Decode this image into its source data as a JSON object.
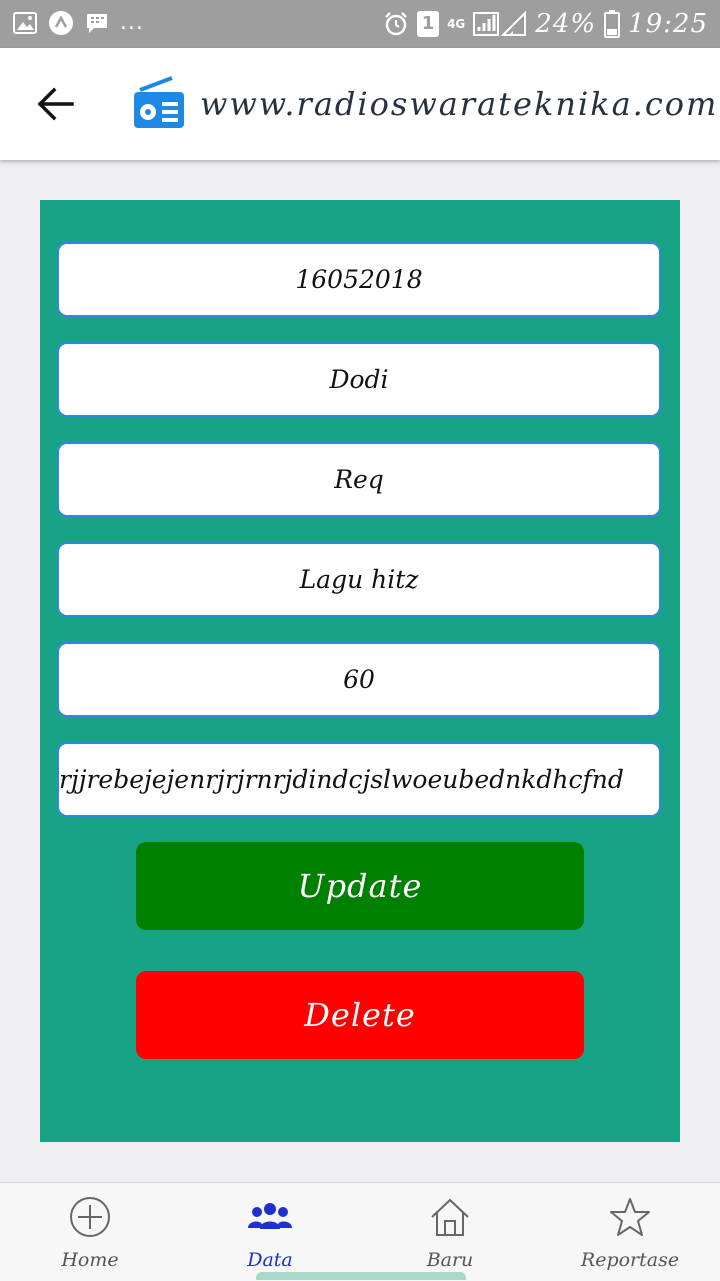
{
  "status_bar": {
    "dots": "...",
    "sim": "1",
    "network": "4G",
    "battery": "24%",
    "time": "19:25"
  },
  "app_bar": {
    "title": "www.radioswarateknika.com",
    "back_icon": "arrow-left-icon",
    "logo_icon": "radio-icon"
  },
  "form": {
    "fields": [
      {
        "value": "16052018"
      },
      {
        "value": "Dodi"
      },
      {
        "value": "Req"
      },
      {
        "value": "Lagu hitz"
      },
      {
        "value": "60"
      },
      {
        "value": "rjjrebejejenrjrjrnrjdindcjslwoeubednkdhcfnd"
      }
    ],
    "update_label": "Update",
    "delete_label": "Delete",
    "colors": {
      "panel": "#19a386",
      "update": "#008000",
      "delete": "#ff0000"
    }
  },
  "bottom_nav": {
    "items": [
      {
        "label": "Home",
        "icon": "plus-circle-icon"
      },
      {
        "label": "Data",
        "icon": "people-icon",
        "active": true
      },
      {
        "label": "Baru",
        "icon": "house-icon"
      },
      {
        "label": "Reportase",
        "icon": "star-icon"
      }
    ]
  }
}
